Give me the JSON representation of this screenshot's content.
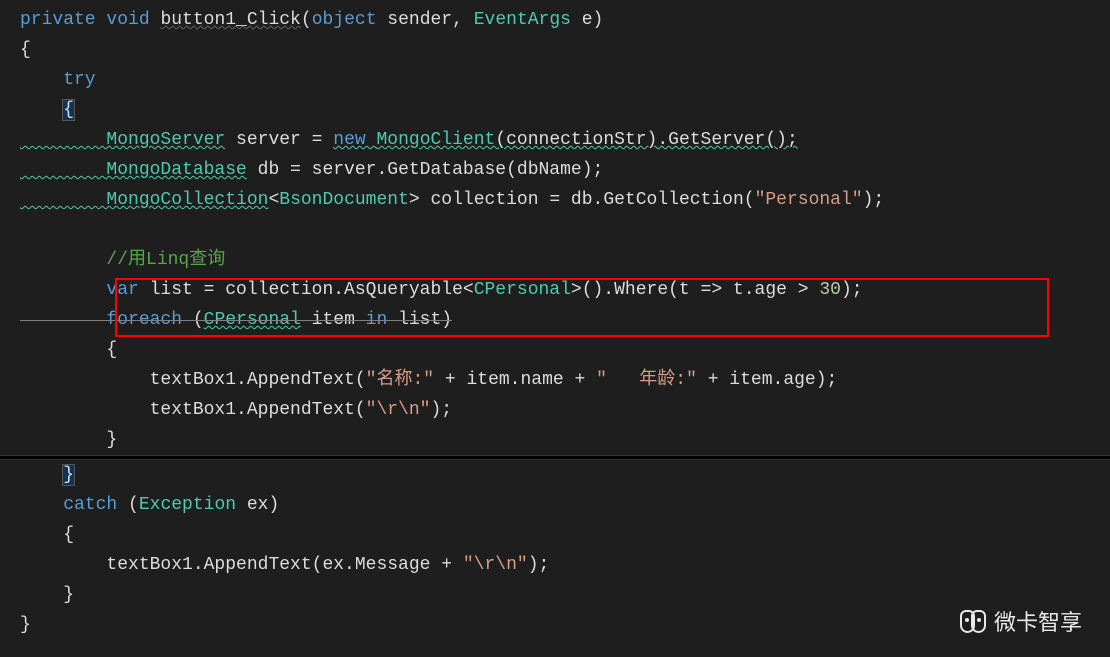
{
  "code": {
    "l1_private": "private",
    "l1_void": " void ",
    "l1_method": "button1_Click",
    "l1_p1": "(",
    "l1_object": "object",
    "l1_sender": " sender, ",
    "l1_eventargs": "EventArgs",
    "l1_e": " e)",
    "l2": "{",
    "l3_try": "    try",
    "l4": "    {",
    "l5_type": "        MongoServer",
    "l5_var": " server = ",
    "l5_new": "new ",
    "l5_client": "MongoClient",
    "l5_rest": "(connectionStr).GetServer();",
    "l6_type": "        MongoDatabase",
    "l6_rest": " db = server.GetDatabase(dbName);",
    "l7_type": "        MongoCollection",
    "l7_lt": "<",
    "l7_bson": "BsonDocument",
    "l7_gt": ">",
    "l7_coll": " collection = db.GetCollection(",
    "l7_str": "\"Personal\"",
    "l7_end": ");",
    "l9_comment": "        //用Linq查询",
    "l10_var": "        var",
    "l10_a": " list = collection.AsQueryable<",
    "l10_type": "CPersonal",
    "l10_b": ">().Where(t => t.age > ",
    "l10_num": "30",
    "l10_c": ");",
    "l11_foreach": "        foreach ",
    "l11_p": "(",
    "l11_type": "CPersonal",
    "l11_item": " item ",
    "l11_in": "in",
    "l11_list": " list)",
    "l12": "        {",
    "l13_a": "            textBox1.AppendText(",
    "l13_s1": "\"名称:\"",
    "l13_b": " + item.name + ",
    "l13_s2": "\"   年龄:\"",
    "l13_c": " + item.age);",
    "l14_a": "            textBox1.AppendText(",
    "l14_s": "\"\\r\\n\"",
    "l14_b": ");",
    "l15": "        }",
    "l16": "    }",
    "l17_catch": "    catch ",
    "l17_p": "(",
    "l17_type": "Exception",
    "l17_ex": " ex)",
    "l18": "    {",
    "l19_a": "        textBox1.AppendText(ex.Message + ",
    "l19_s": "\"\\r\\n\"",
    "l19_b": ");",
    "l20": "    }",
    "l21": "}"
  },
  "watermark": "微卡智享"
}
